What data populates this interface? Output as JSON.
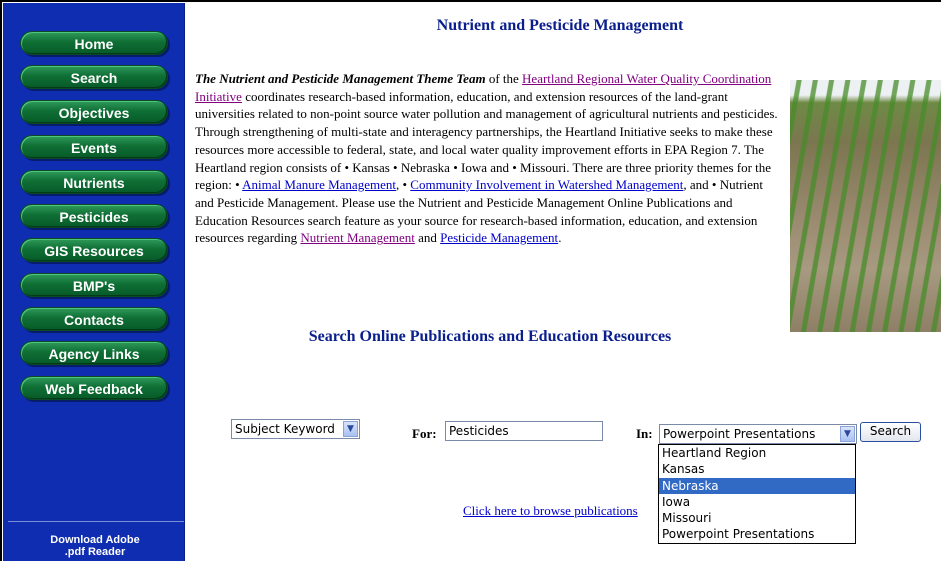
{
  "sidebar": {
    "items": [
      {
        "label": "Home"
      },
      {
        "label": "Search"
      },
      {
        "label": "Objectives"
      },
      {
        "label": "Events"
      },
      {
        "label": "Nutrients"
      },
      {
        "label": "Pesticides"
      },
      {
        "label": "GIS Resources"
      },
      {
        "label": "BMP's"
      },
      {
        "label": "Contacts"
      },
      {
        "label": "Agency Links"
      },
      {
        "label": "Web Feedback"
      }
    ],
    "download_line1": "Download Adobe",
    "download_line2": ".pdf Reader"
  },
  "header": {
    "title": "Nutrient and Pesticide Management"
  },
  "intro": {
    "lead": "The Nutrient and Pesticide Management Theme Team",
    "t1": " of the ",
    "link_heartland": "Heartland Regional Water Quality Coordination Initiative",
    "t2": " coordinates research-based information, education, and extension resources of the land-grant universities related to non-point source water pollution and management of agricultural nutrients and pesticides. Through strengthening of multi-state and interagency partnerships, the Heartland Initiative seeks to make these resources more accessible to federal, state, and local water quality improvement efforts in EPA Region 7. The Heartland region consists of • Kansas • Nebraska • Iowa and • Missouri. There are three priority themes for the region: • ",
    "link_manure": "Animal Manure Management",
    "t3": ", • ",
    "link_community": " Community Involvement in Watershed Management",
    "t4": ", and • Nutrient and Pesticide Management. Please use the Nutrient and Pesticide Management Online Publications and Education Resources search feature as your source for research-based information, education, and extension resources regarding ",
    "link_nutrient": "Nutrient Management",
    "t5": " and ",
    "link_pesticide": "Pesticide Management",
    "t6": "."
  },
  "search": {
    "heading": "Search Online Publications and Education Resources",
    "subject_select": "Subject Keyword",
    "for_label": "For:",
    "for_value": "Pesticides",
    "in_label": "In:",
    "in_select": "Powerpoint Presentations",
    "button": "Search",
    "options": [
      {
        "label": "Heartland Region"
      },
      {
        "label": "Kansas"
      },
      {
        "label": "Nebraska",
        "highlighted": true
      },
      {
        "label": "Iowa"
      },
      {
        "label": "Missouri"
      },
      {
        "label": "Powerpoint Presentations"
      }
    ],
    "browse_link": "Click here to browse publications"
  },
  "icons": {
    "dropdown_arrow": "chevron-down-icon"
  },
  "colors": {
    "sidebar": "#0e2db0",
    "nav_button": "#0f6f35",
    "heading": "#0a1e8c",
    "highlight": "#316ac5"
  }
}
